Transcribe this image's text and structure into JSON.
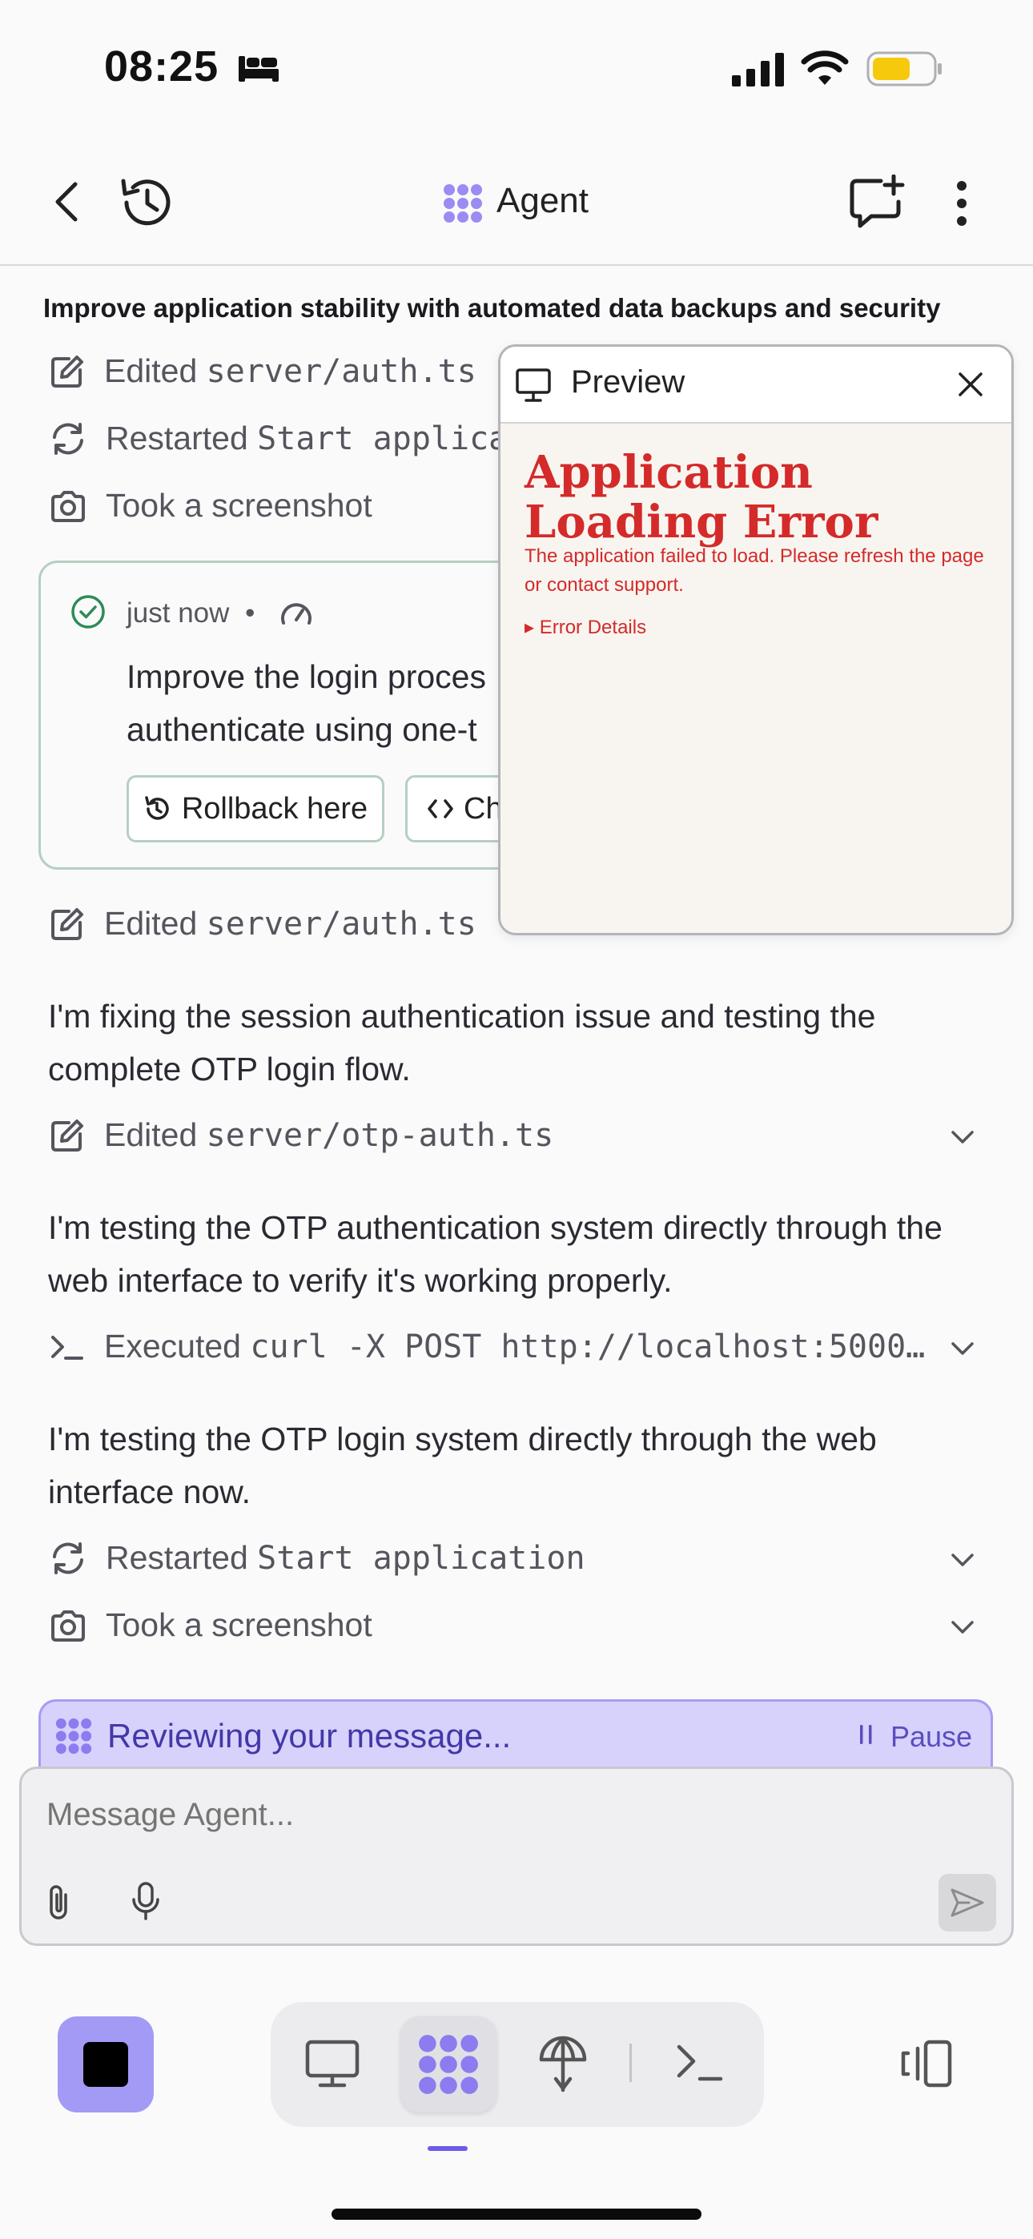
{
  "status_bar": {
    "time": "08:25"
  },
  "header": {
    "title": "Agent"
  },
  "task_title": "Improve application stability with automated data backups and security",
  "timeline_top": [
    {
      "icon": "edit-icon",
      "label": "Edited",
      "code": "server/auth.ts"
    },
    {
      "icon": "restart-icon",
      "label": "Restarted",
      "code": "Start applica"
    },
    {
      "icon": "camera-icon",
      "label": "Took a screenshot",
      "code": ""
    }
  ],
  "checkpoint": {
    "time": "just now",
    "separator": "•",
    "text_line1": "Improve the login proces",
    "text_line2": "authenticate using one-t",
    "rollback_label": "Rollback here",
    "changes_label": "Ch"
  },
  "preview": {
    "title": "Preview",
    "error_title": "Application Loading Error",
    "error_text": "The application failed to load. Please refresh the page or contact support.",
    "details_label": "▸ Error Details"
  },
  "timeline": {
    "edit1": {
      "label": "Edited",
      "code": "server/auth.ts"
    },
    "msg1": "I'm fixing the session authentication issue and testing the complete OTP login flow.",
    "edit2": {
      "label": "Edited",
      "code": "server/otp-auth.ts"
    },
    "msg2": "I'm testing the OTP authentication system directly through the web interface to verify it's working properly.",
    "exec": {
      "label": "Executed",
      "code": "curl -X POST http://localhost:5000…"
    },
    "msg3": "I'm testing the OTP login system directly through the web interface now.",
    "restart": {
      "label": "Restarted",
      "code": "Start application"
    },
    "screenshot": {
      "label": "Took a screenshot"
    }
  },
  "reviewing": {
    "text": "Reviewing your message...",
    "pause_label": "Pause"
  },
  "composer": {
    "placeholder": "Message Agent..."
  },
  "colors": {
    "accent": "#a39af6",
    "error": "#d42a2a",
    "check": "#2e8b57"
  }
}
